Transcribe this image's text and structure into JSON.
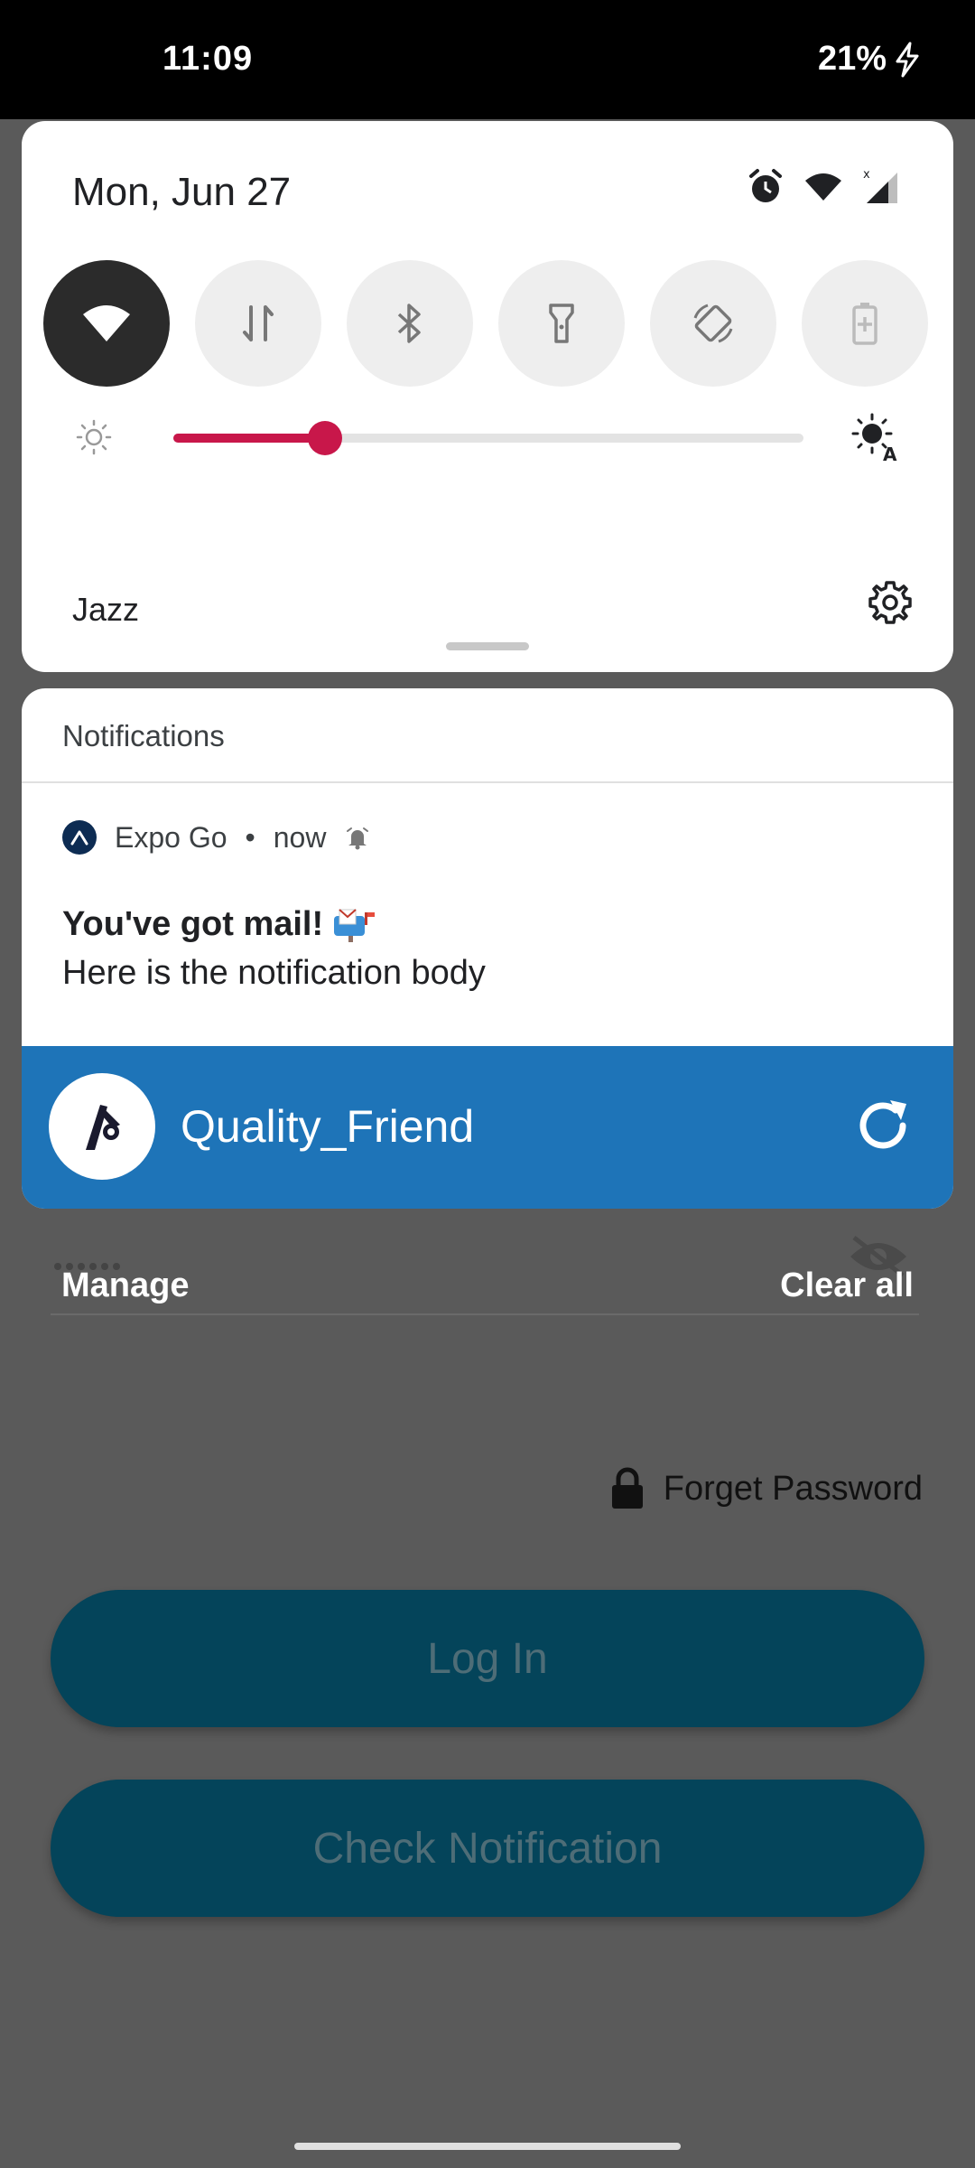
{
  "status_bar": {
    "time": "11:09",
    "battery": "21%"
  },
  "quick_settings": {
    "date": "Mon, Jun 27",
    "carrier": "Jazz",
    "brightness_level": 0.24,
    "tiles": [
      {
        "name": "wifi",
        "active": true
      },
      {
        "name": "mobile-data",
        "active": false
      },
      {
        "name": "bluetooth",
        "active": false
      },
      {
        "name": "flashlight",
        "active": false
      },
      {
        "name": "auto-rotate",
        "active": false
      },
      {
        "name": "battery-saver",
        "active": false
      }
    ]
  },
  "notifications": {
    "header": "Notifications",
    "expo": {
      "app_name": "Expo Go",
      "separator": "•",
      "time": "now",
      "title": "You've got mail!",
      "body": "Here is the notification body"
    },
    "media": {
      "label": "Quality_Friend"
    },
    "actions": {
      "manage": "Manage",
      "clear_all": "Clear all"
    }
  },
  "app_background": {
    "forget_password": "Forget Password",
    "login_button": "Log In",
    "check_button": "Check Notification"
  },
  "colors": {
    "accent": "#c8174a",
    "media_blue": "#1e74b8",
    "button_teal": "#04445a",
    "scrim": "#5a5a5a"
  }
}
